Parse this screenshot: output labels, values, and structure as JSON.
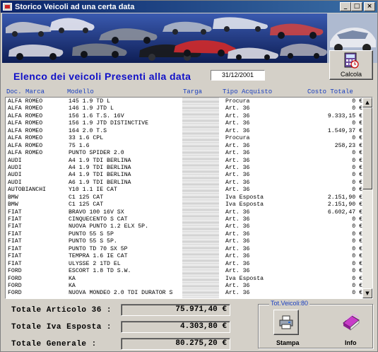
{
  "window": {
    "title": "Storico Veicoli ad una certa data",
    "buttons": [
      "_",
      "□",
      "×"
    ]
  },
  "toolbar": {
    "calcola_label": "Calcola"
  },
  "heading": {
    "title": "Elenco dei veicoli Presenti alla data",
    "date": "31/12/2001"
  },
  "columns": {
    "marca": "Doc. Marca",
    "modello": "Modello",
    "targa": "Targa",
    "tipo": "Tipo Acquisto",
    "costo": "Costo Totale"
  },
  "rows": [
    {
      "marca": "ALFA ROMEO",
      "modello": "145 1.9 TD L",
      "tipo": "Procura",
      "costo": "0 €"
    },
    {
      "marca": "ALFA ROMEO",
      "modello": "146 1.9 JTD L",
      "tipo": "Art. 36",
      "costo": "0 €"
    },
    {
      "marca": "ALFA ROMEO",
      "modello": "156 1.6 T.S. 16V",
      "tipo": "Art. 36",
      "costo": "9.333,15 €"
    },
    {
      "marca": "ALFA ROMEO",
      "modello": "156 1.9 JTD DISTINCTIVE",
      "tipo": "Art. 36",
      "costo": "0 €"
    },
    {
      "marca": "ALFA ROMEO",
      "modello": "164 2.0 T.S",
      "tipo": "Art. 36",
      "costo": "1.549,37 €"
    },
    {
      "marca": "ALFA ROMEO",
      "modello": "33 1.6 CPL",
      "tipo": "Procura",
      "costo": "0 €"
    },
    {
      "marca": "ALFA ROMEO",
      "modello": "75 1.6",
      "tipo": "Art. 36",
      "costo": "258,23 €"
    },
    {
      "marca": "ALFA ROMEO",
      "modello": "PUNTO SPIDER 2.0",
      "tipo": "Art. 36",
      "costo": "0 €"
    },
    {
      "marca": "AUDI",
      "modello": "A4 1.9 TDI BERLINA",
      "tipo": "Art. 36",
      "costo": "0 €"
    },
    {
      "marca": "AUDI",
      "modello": "A4 1.9 TDI BERLINA",
      "tipo": "Art. 36",
      "costo": "0 €"
    },
    {
      "marca": "AUDI",
      "modello": "A4 1.9 TDI BERLINA",
      "tipo": "Art. 36",
      "costo": "0 €"
    },
    {
      "marca": "AUDI",
      "modello": "A6 1.9 TDI BERLINA",
      "tipo": "Art. 36",
      "costo": "0 €"
    },
    {
      "marca": "AUTOBIANCHI",
      "modello": "Y10 1.1 IE CAT",
      "tipo": "Art. 36",
      "costo": "0 €"
    },
    {
      "marca": "BMW",
      "modello": "C1 125 CAT",
      "tipo": "Iva Esposta",
      "costo": "2.151,90 €"
    },
    {
      "marca": "BMW",
      "modello": "C1 125 CAT",
      "tipo": "Iva Esposta",
      "costo": "2.151,90 €"
    },
    {
      "marca": "FIAT",
      "modello": "BRAVO 100 16V SX",
      "tipo": "Art. 36",
      "costo": "6.602,47 €"
    },
    {
      "marca": "FIAT",
      "modello": "CINQUECENTO S CAT",
      "tipo": "Art. 36",
      "costo": "0 €"
    },
    {
      "marca": "FIAT",
      "modello": "NUOVA PUNTO 1.2 ELX 5P.",
      "tipo": "Art. 36",
      "costo": "0 €"
    },
    {
      "marca": "FIAT",
      "modello": "PUNTO 55 S 5P",
      "tipo": "Art. 36",
      "costo": "0 €"
    },
    {
      "marca": "FIAT",
      "modello": "PUNTO 55 S 5P.",
      "tipo": "Art. 36",
      "costo": "0 €"
    },
    {
      "marca": "FIAT",
      "modello": "PUNTO TD 70 SX 5P",
      "tipo": "Art. 36",
      "costo": "0 €"
    },
    {
      "marca": "FIAT",
      "modello": "TEMPRA 1.6 IE CAT",
      "tipo": "Art. 36",
      "costo": "0 €"
    },
    {
      "marca": "FIAT",
      "modello": "ULYSSE 2 1TD EL",
      "tipo": "Art. 36",
      "costo": "0 €"
    },
    {
      "marca": "FORD",
      "modello": "ESCORT 1.8 TD S.W.",
      "tipo": "Art. 36",
      "costo": "0 €"
    },
    {
      "marca": "FORD",
      "modello": "KA",
      "tipo": "Iva Esposta",
      "costo": "0 €"
    },
    {
      "marca": "FORD",
      "modello": "KA",
      "tipo": "Art. 36",
      "costo": "0 €"
    },
    {
      "marca": "FORD",
      "modello": "NUOVA MONDEO 2.0 TDI DURATOR S",
      "tipo": "Art. 36",
      "costo": "0 €"
    }
  ],
  "totals": {
    "art36_label": "Totale Articolo 36 :",
    "art36_value": "75.971,40 €",
    "iva_label": "Totale Iva Esposta :",
    "iva_value": "4.303,80 €",
    "generale_label": "Totale Generale    :",
    "generale_value": "80.275,20 €"
  },
  "actions": {
    "group_title": "Tot.Veicoli:80",
    "stampa_label": "Stampa",
    "info_label": "Info"
  },
  "scrollbar": {
    "position": 0.0
  }
}
